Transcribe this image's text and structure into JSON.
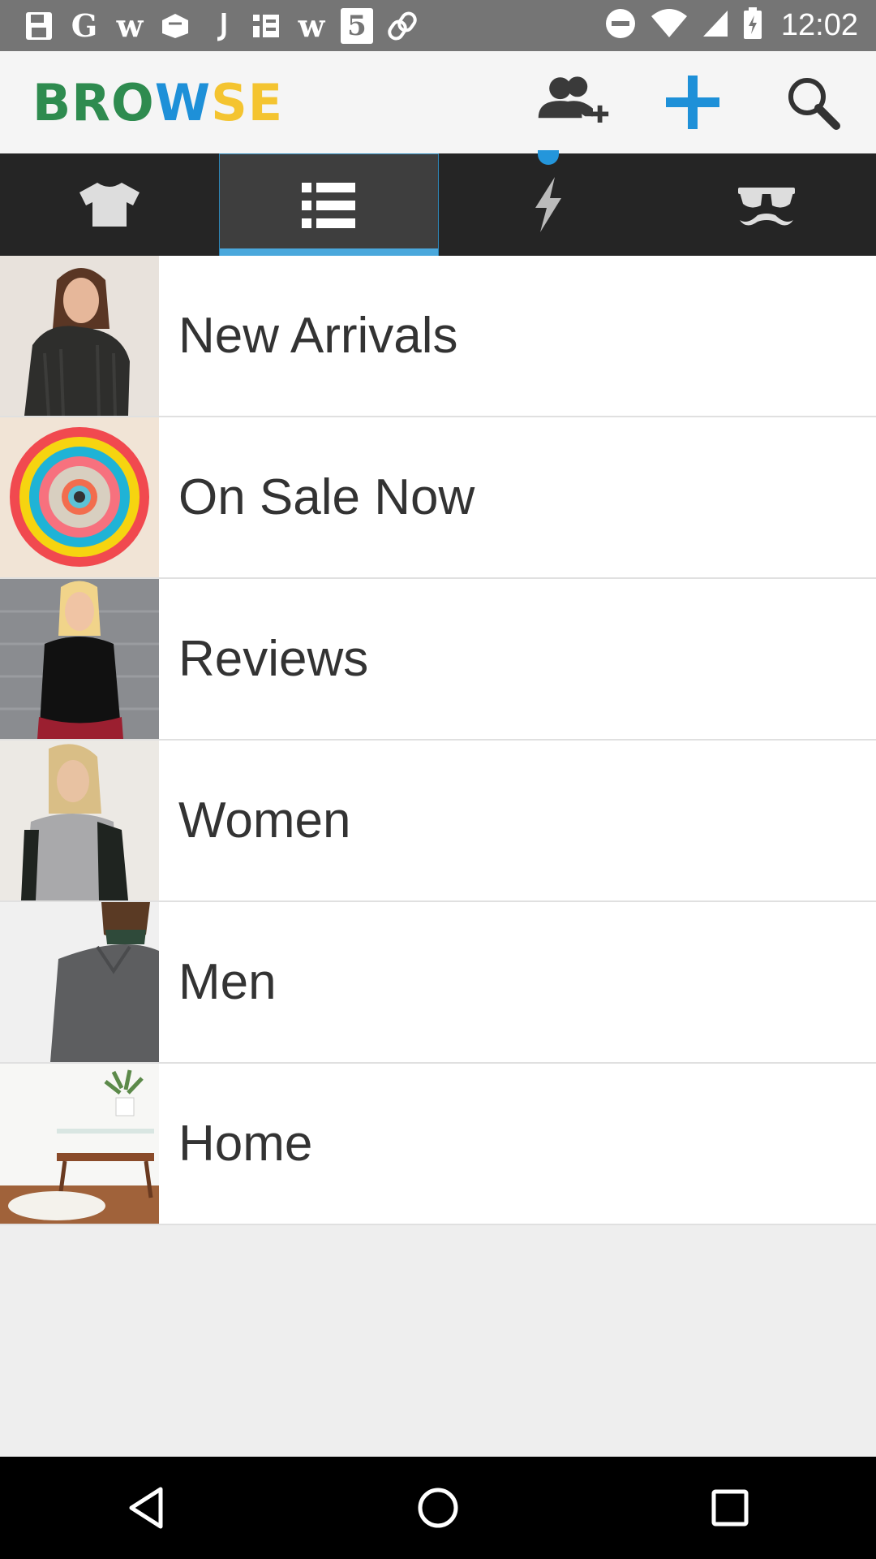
{
  "status_bar": {
    "time": "12:02",
    "notification_icons": [
      "G",
      "w",
      "w",
      "5"
    ],
    "notification_icon_names": [
      "save-icon",
      "google-icon",
      "w-icon",
      "box-icon",
      "j-icon",
      "taobao-icon",
      "w-icon",
      "html5-icon",
      "link-icon"
    ],
    "system_icons": [
      "do-not-disturb-icon",
      "wifi-icon",
      "signal-icon",
      "battery-icon"
    ]
  },
  "app_bar": {
    "title_part1": "BRO",
    "title_part2": "W",
    "title_part3": "SE",
    "actions": [
      "add-friend-icon",
      "plus-icon",
      "search-icon"
    ]
  },
  "tabs": [
    {
      "name": "tshirt-icon",
      "active": false
    },
    {
      "name": "list-icon",
      "active": true
    },
    {
      "name": "lightning-icon",
      "active": false,
      "badge": true
    },
    {
      "name": "disguise-icon",
      "active": false
    }
  ],
  "categories": [
    {
      "label": "New Arrivals"
    },
    {
      "label": "On Sale Now"
    },
    {
      "label": "Reviews"
    },
    {
      "label": "Women"
    },
    {
      "label": "Men"
    },
    {
      "label": "Home"
    }
  ],
  "nav": [
    "back-icon",
    "home-icon",
    "recents-icon"
  ],
  "colors": {
    "accent": "#1e90d8",
    "brand_green": "#2e8b4f",
    "brand_yellow": "#f4c430",
    "tab_indicator": "#4aa8dc"
  }
}
